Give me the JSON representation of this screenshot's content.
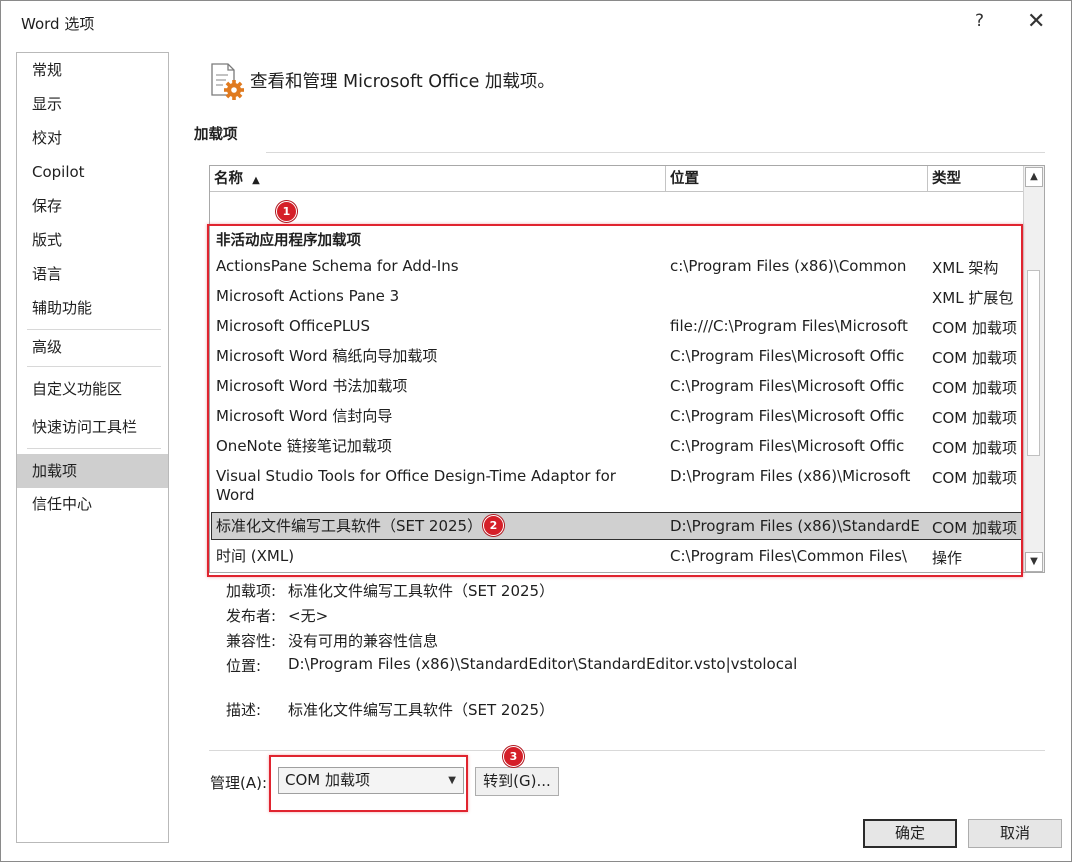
{
  "window": {
    "title": "Word 选项",
    "help_glyph": "?",
    "close_glyph": "✕"
  },
  "sidebar": {
    "items": [
      {
        "label": "常规"
      },
      {
        "label": "显示"
      },
      {
        "label": "校对"
      },
      {
        "label": "Copilot"
      },
      {
        "label": "保存"
      },
      {
        "label": "版式"
      },
      {
        "label": "语言"
      },
      {
        "label": "辅助功能"
      },
      {
        "label": "高级"
      },
      {
        "label": "自定义功能区"
      },
      {
        "label": "快速访问工具栏"
      },
      {
        "label": "加载项",
        "selected": true
      },
      {
        "label": "信任中心"
      }
    ]
  },
  "header": {
    "text": "查看和管理 Microsoft Office 加载项。",
    "icon": "addins-settings-icon"
  },
  "section": {
    "label": "加载项"
  },
  "list": {
    "columns": {
      "name": "名称",
      "sort_glyph": "▲",
      "location": "位置",
      "type": "类型"
    },
    "group_heading": "非活动应用程序加载项",
    "rows": [
      {
        "name": "ActionsPane Schema for Add-Ins",
        "location": "c:\\Program Files (x86)\\Common",
        "type": "XML 架构"
      },
      {
        "name": "Microsoft Actions Pane 3",
        "location": "",
        "type": "XML 扩展包"
      },
      {
        "name": "Microsoft OfficePLUS",
        "location": "file:///C:\\Program Files\\Microsoft",
        "type": "COM 加载项"
      },
      {
        "name": "Microsoft Word 稿纸向导加载项",
        "location": "C:\\Program Files\\Microsoft Offic",
        "type": "COM 加载项"
      },
      {
        "name": "Microsoft Word 书法加载项",
        "location": "C:\\Program Files\\Microsoft Offic",
        "type": "COM 加载项"
      },
      {
        "name": "Microsoft Word 信封向导",
        "location": "C:\\Program Files\\Microsoft Offic",
        "type": "COM 加载项"
      },
      {
        "name": "OneNote 链接笔记加载项",
        "location": "C:\\Program Files\\Microsoft Offic",
        "type": "COM 加载项"
      },
      {
        "name": "Visual Studio Tools for Office Design-Time Adaptor for Word",
        "location": "D:\\Program Files (x86)\\Microsoft",
        "type": "COM 加载项"
      },
      {
        "name": "标准化文件编写工具软件（SET 2025）",
        "location": "D:\\Program Files (x86)\\StandardE",
        "type": "COM 加载项",
        "selected": true
      },
      {
        "name": "时间 (XML)",
        "location": "C:\\Program Files\\Common Files\\",
        "type": "操作"
      }
    ]
  },
  "details": {
    "addin_label": "加载项:",
    "addin_value": "标准化文件编写工具软件（SET 2025）",
    "publisher_label": "发布者:",
    "publisher_value": "<无>",
    "compat_label": "兼容性:",
    "compat_value": "没有可用的兼容性信息",
    "location_label": "位置:",
    "location_value": "D:\\Program Files (x86)\\StandardEditor\\StandardEditor.vsto|vstolocal",
    "desc_label": "描述:",
    "desc_value": "标准化文件编写工具软件（SET 2025）"
  },
  "manage": {
    "label": "管理(A):",
    "selected": "COM 加载项",
    "go_button": "转到(G)..."
  },
  "buttons": {
    "ok": "确定",
    "cancel": "取消"
  },
  "annotations": {
    "badge1": "1",
    "badge2": "2",
    "badge3": "3",
    "highlight_color": "#e0242f"
  }
}
